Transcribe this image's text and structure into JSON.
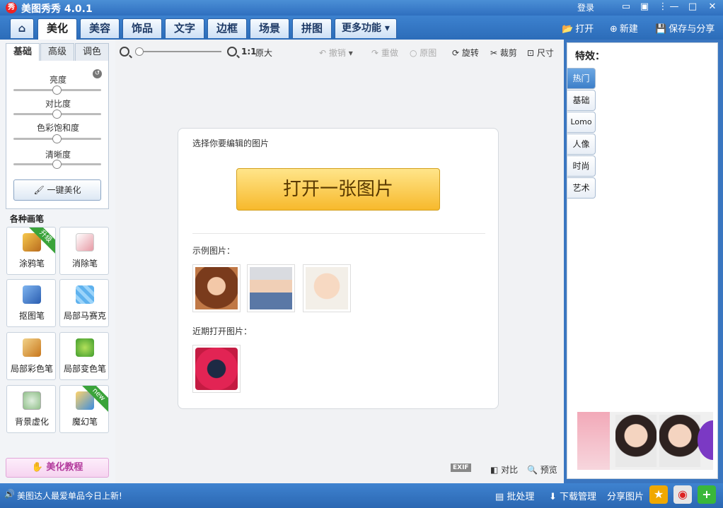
{
  "app": {
    "title": "美图秀秀 4.0.1",
    "logo_text": "秀",
    "login": "登录"
  },
  "window_controls": [
    "message-icon",
    "menu-icon",
    "settings-icon",
    "minimize-icon",
    "maximize-icon",
    "close-icon"
  ],
  "tabs": {
    "home_icon": "home-icon",
    "items": [
      {
        "label": "美化",
        "active": true
      },
      {
        "label": "美容"
      },
      {
        "label": "饰品"
      },
      {
        "label": "文字"
      },
      {
        "label": "边框"
      },
      {
        "label": "场景"
      },
      {
        "label": "拼图"
      }
    ],
    "more": "更多功能"
  },
  "top_actions": {
    "open": "打开",
    "new": "新建",
    "save_share": "保存与分享"
  },
  "left": {
    "subtabs": [
      "基础",
      "高级",
      "调色"
    ],
    "adjustments": [
      {
        "label": "亮度",
        "value": 0.5
      },
      {
        "label": "对比度",
        "value": 0.5
      },
      {
        "label": "色彩饱和度",
        "value": 0.5
      },
      {
        "label": "清晰度",
        "value": 0.5
      }
    ],
    "onekey": "一键美化",
    "brushes_title": "各种画笔",
    "brushes": [
      {
        "label": "涂鸦笔",
        "badge": "升级"
      },
      {
        "label": "消除笔"
      },
      {
        "label": "抠图笔"
      },
      {
        "label": "局部马赛克"
      },
      {
        "label": "局部彩色笔"
      },
      {
        "label": "局部变色笔"
      },
      {
        "label": "背景虚化"
      },
      {
        "label": "魔幻笔",
        "badge": "new"
      }
    ],
    "tutorial": "美化教程"
  },
  "canvas": {
    "zoom_ratio": "1:1",
    "zoom_original": "原大",
    "undo": "撤销",
    "redo": "重做",
    "original": "原图",
    "rotate": "旋转",
    "crop": "裁剪",
    "size": "尺寸",
    "card": {
      "select_label": "选择你要编辑的图片",
      "open_button": "打开一张图片",
      "examples_label": "示例图片：",
      "recent_label": "近期打开图片："
    },
    "exif": "EXIF",
    "compare": "对比",
    "preview": "预览"
  },
  "right": {
    "title": "特效：",
    "items": [
      {
        "label": "热门",
        "active": true
      },
      {
        "label": "基础"
      },
      {
        "label": "Lomo"
      },
      {
        "label": "人像"
      },
      {
        "label": "时尚"
      },
      {
        "label": "艺术"
      }
    ]
  },
  "status": {
    "message": "美图达人最爱单品今日上新!",
    "batch": "批处理",
    "download": "下载管理",
    "share": "分享图片"
  },
  "colors": {
    "accent": "#3a76c0",
    "open_button": "#f7b92c",
    "active_fx": "#3d7fc9"
  }
}
